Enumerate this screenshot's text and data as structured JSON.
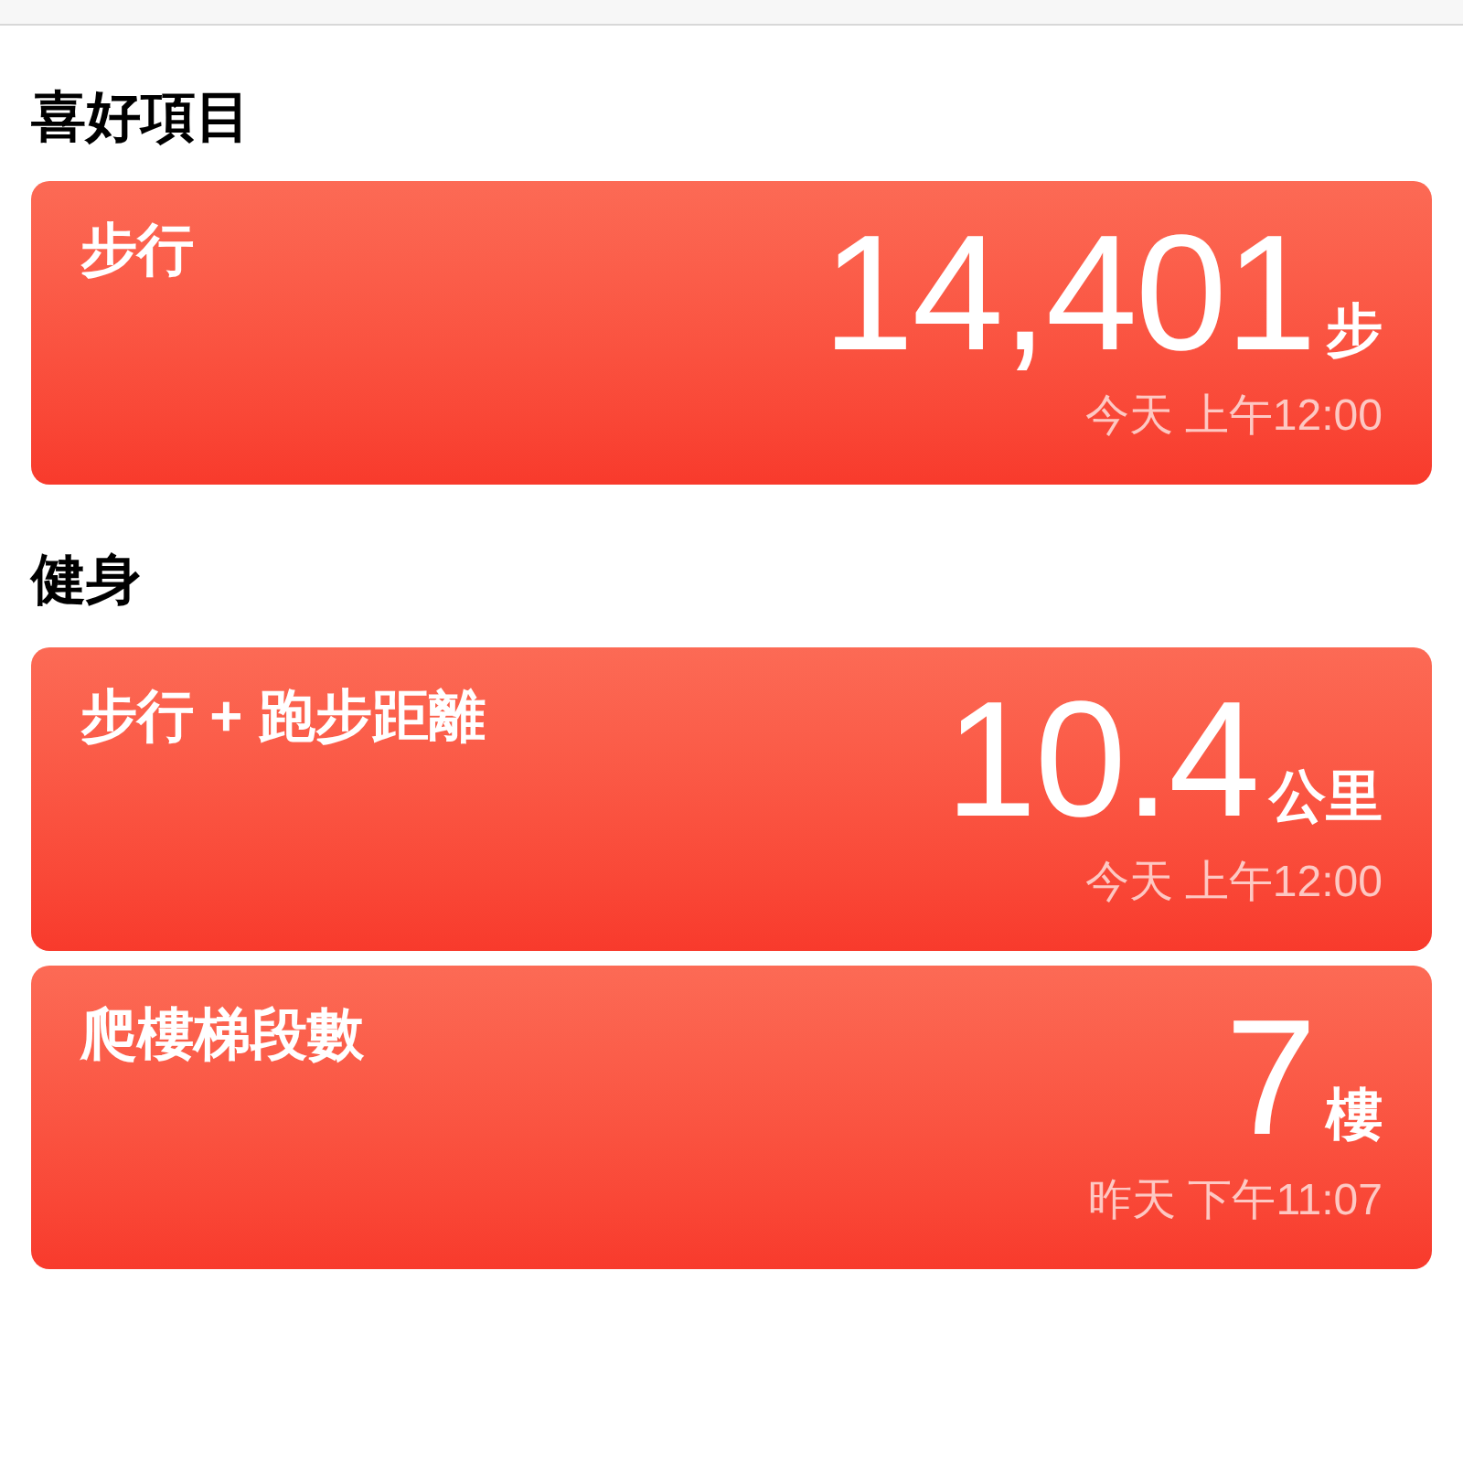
{
  "sections": [
    {
      "title": "喜好項目",
      "cards": [
        {
          "title": "步行",
          "value": "14,401",
          "unit": "步",
          "time": "今天 上午12:00"
        }
      ]
    },
    {
      "title": "健身",
      "cards": [
        {
          "title": "步行 + 跑步距離",
          "value": "10.4",
          "unit": "公里",
          "time": "今天 上午12:00"
        },
        {
          "title": "爬樓梯段數",
          "value": "7",
          "unit": "樓",
          "time": "昨天 下午11:07"
        }
      ]
    }
  ]
}
